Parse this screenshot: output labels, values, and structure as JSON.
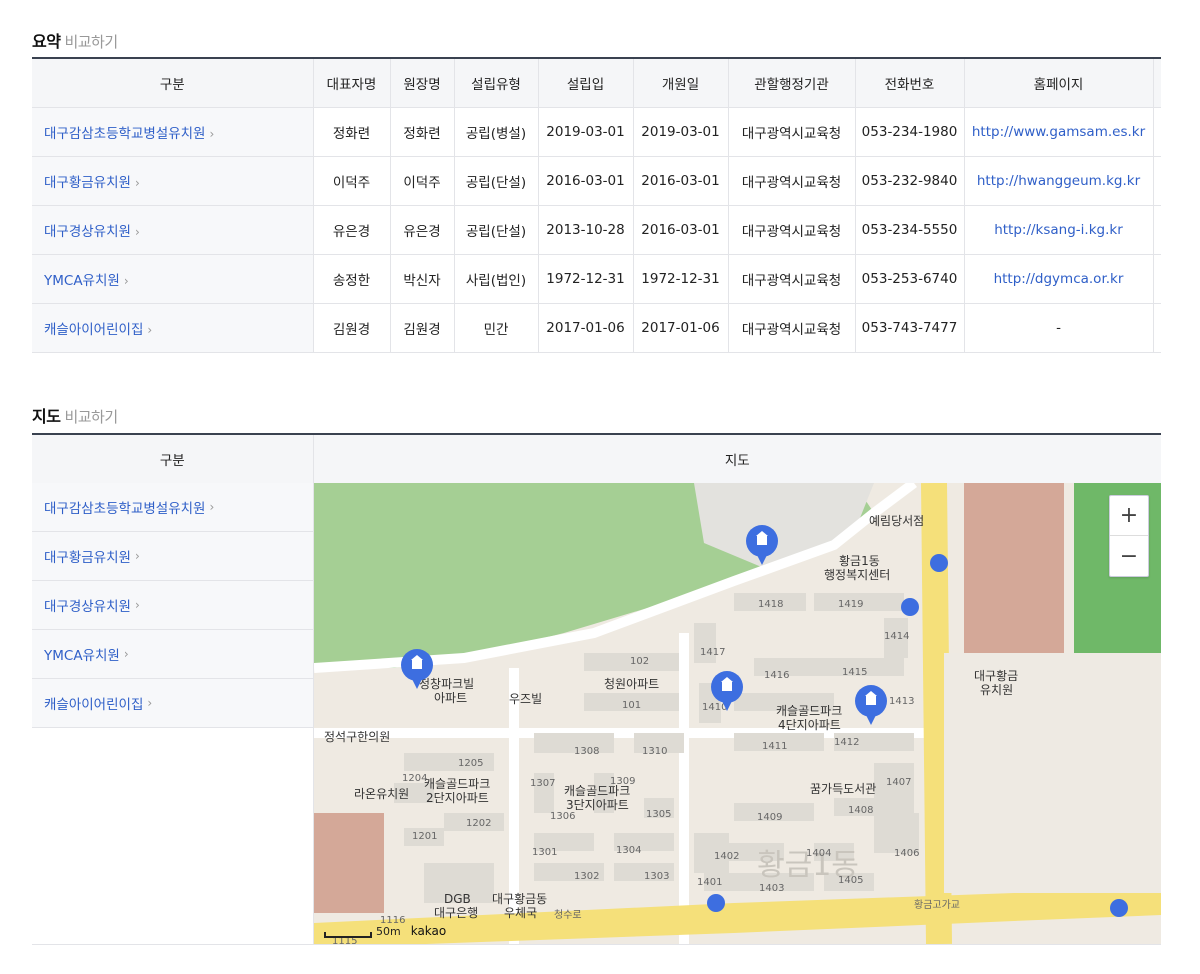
{
  "summary": {
    "title": "요약",
    "subtitle": "비교하기",
    "headers": [
      "구분",
      "대표자명",
      "원장명",
      "설립유형",
      "설립입",
      "개원일",
      "관할행정기관",
      "전화번호",
      "홈페이지"
    ],
    "rows": [
      {
        "name": "대구감삼초등학교병설유치원",
        "rep": "정화련",
        "director": "정화련",
        "type": "공립(병설)",
        "established": "2019-03-01",
        "opened": "2019-03-01",
        "authority": "대구광역시교육청",
        "phone": "053-234-1980",
        "homepage": "http://www.gamsam.es.kr"
      },
      {
        "name": "대구황금유치원",
        "rep": "이덕주",
        "director": "이덕주",
        "type": "공립(단설)",
        "established": "2016-03-01",
        "opened": "2016-03-01",
        "authority": "대구광역시교육청",
        "phone": "053-232-9840",
        "homepage": "http://hwanggeum.kg.kr"
      },
      {
        "name": "대구경상유치원",
        "rep": "유은경",
        "director": "유은경",
        "type": "공립(단설)",
        "established": "2013-10-28",
        "opened": "2016-03-01",
        "authority": "대구광역시교육청",
        "phone": "053-234-5550",
        "homepage": "http://ksang-i.kg.kr"
      },
      {
        "name": "YMCA유치원",
        "rep": "송정한",
        "director": "박신자",
        "type": "사립(법인)",
        "established": "1972-12-31",
        "opened": "1972-12-31",
        "authority": "대구광역시교육청",
        "phone": "053-253-6740",
        "homepage": "http://dgymca.or.kr"
      },
      {
        "name": "캐슬아이어린이집",
        "rep": "김원경",
        "director": "김원경",
        "type": "민간",
        "established": "2017-01-06",
        "opened": "2017-01-06",
        "authority": "대구광역시교육청",
        "phone": "053-743-7477",
        "homepage": "-"
      }
    ]
  },
  "map_section": {
    "title": "지도",
    "subtitle": "비교하기",
    "header_col1": "구분",
    "header_col2": "지도",
    "items": [
      "대구감삼초등학교병설유치원",
      "대구황금유치원",
      "대구경상유치원",
      "YMCA유치원",
      "캐슬아이어린이집"
    ]
  },
  "map": {
    "zoom_in": "+",
    "zoom_out": "−",
    "scale_label": "50m",
    "provider": "kakao",
    "labels": {
      "bookstore1": "예림당서점",
      "center": "황금1동\n행정복지센터",
      "kinder_hg": "대구황금\n유치원",
      "apt_cc": "청창파크빌\n아파트",
      "woojeu": "우즈빌",
      "cheongwon": "청원아파트",
      "castle4": "캐슬골드파크\n4단지아파트",
      "clinic": "정석구한의원",
      "raon": "라온유치원",
      "castle2": "캐슬골드파크\n2단지아파트",
      "castle3": "캐슬골드파크\n3단지아파트",
      "kkumgga": "꿈가득도서관",
      "dgb": "DGB\n대구은행",
      "post": "대구황금동\n우체국",
      "dong": "황금1동",
      "road1": "황금고가교",
      "road2": "청수로",
      "road3": "청호로"
    },
    "bldg": [
      "1418",
      "1419",
      "1417",
      "1414",
      "1416",
      "1415",
      "1413",
      "1410",
      "1411",
      "1412",
      "1407",
      "1409",
      "1408",
      "1402",
      "1404",
      "1406",
      "1401",
      "1403",
      "1405",
      "102",
      "101",
      "1308",
      "1310",
      "1307",
      "1309",
      "1306",
      "1305",
      "1301",
      "1304",
      "1302",
      "1303",
      "1205",
      "1204",
      "1202",
      "1201",
      "1116",
      "1115"
    ]
  }
}
